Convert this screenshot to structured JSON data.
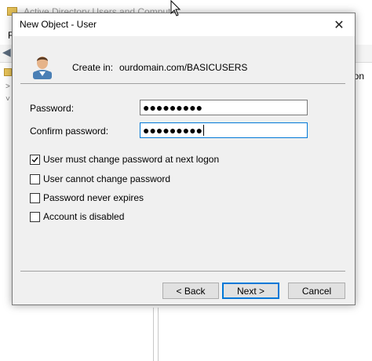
{
  "background_window": {
    "title": "Active Directory Users and Compute",
    "menu_letter": "F",
    "column_header_partial": "ion",
    "tree_glyphs": [
      ">",
      "˅"
    ]
  },
  "dialog": {
    "title": "New Object - User",
    "close_glyph": "✕",
    "create_in_label": "Create in:",
    "create_in_value": "ourdomain.com/BASICUSERS",
    "password_label": "Password:",
    "password_value": "●●●●●●●●●",
    "confirm_label": "Confirm password:",
    "confirm_value": "●●●●●●●●●",
    "options": [
      {
        "label": "User must change password at next logon",
        "checked": true
      },
      {
        "label": "User cannot change password",
        "checked": false
      },
      {
        "label": "Password never expires",
        "checked": false
      },
      {
        "label": "Account is disabled",
        "checked": false
      }
    ],
    "buttons": {
      "back": "< Back",
      "next": "Next >",
      "cancel": "Cancel"
    }
  },
  "icons": {
    "dialog_icon": "user-icon",
    "close": "close-icon",
    "back_arrow": "back-arrow-icon",
    "folder": "folder-icon"
  },
  "colors": {
    "dialog_bg": "#f0f0f0",
    "focus_border": "#0078d7",
    "button_bg": "#e1e1e1"
  }
}
